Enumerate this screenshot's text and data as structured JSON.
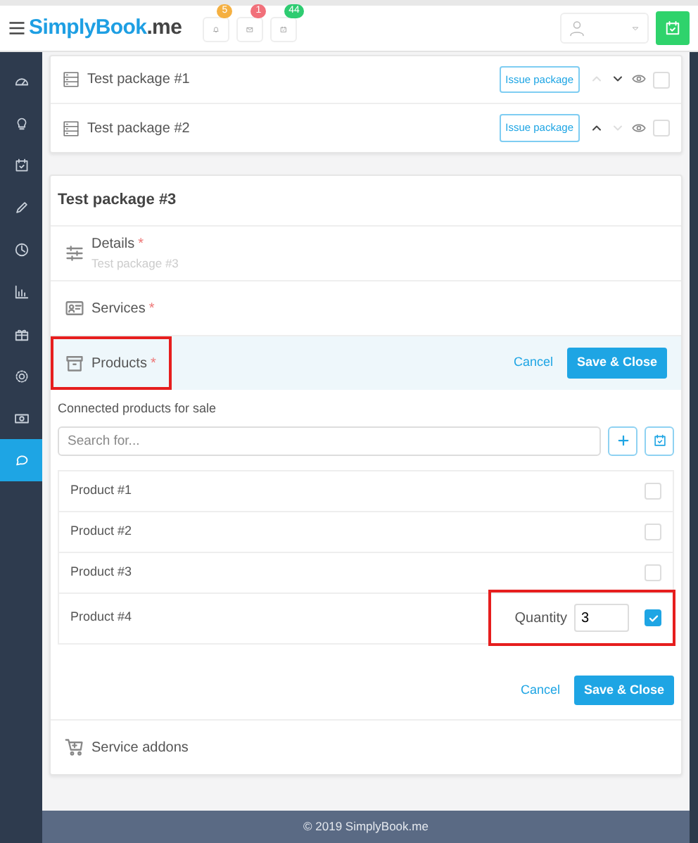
{
  "header": {
    "brand_name": "SimplyBook",
    "brand_suffix": ".me",
    "notifications": [
      {
        "count": "5",
        "color": "#f5b041"
      },
      {
        "count": "1",
        "color": "#f1707a"
      },
      {
        "count": "44",
        "color": "#2ecc71"
      }
    ]
  },
  "sidebar": {
    "items": [
      {
        "selected": false
      },
      {
        "selected": false
      },
      {
        "selected": false
      },
      {
        "selected": false
      },
      {
        "selected": false
      },
      {
        "selected": false
      },
      {
        "selected": false
      },
      {
        "selected": false
      },
      {
        "selected": false
      },
      {
        "selected": true
      }
    ]
  },
  "packages": [
    {
      "name": "Test package #1",
      "action": "Issue package",
      "up_disabled": true,
      "down_disabled": false,
      "checked": false
    },
    {
      "name": "Test package #2",
      "action": "Issue package",
      "up_disabled": false,
      "down_disabled": true,
      "checked": false
    }
  ],
  "editor": {
    "title": "Test package #3",
    "sections": [
      {
        "label": "Details",
        "required_mark": "*",
        "subtitle": "Test package #3",
        "expanded": false,
        "highlighted": false
      },
      {
        "label": "Services",
        "required_mark": "*",
        "expanded": false,
        "highlighted": false
      },
      {
        "label": "Products",
        "required_mark": "*",
        "expanded": true,
        "highlighted": true,
        "cancel": "Cancel",
        "save": "Save & Close"
      }
    ],
    "products_panel": {
      "caption": "Connected products for sale",
      "search_placeholder": "Search for...",
      "products": [
        {
          "name": "Product #1",
          "checked": false,
          "highlighted": false
        },
        {
          "name": "Product #2",
          "checked": false,
          "highlighted": false
        },
        {
          "name": "Product #3",
          "checked": false,
          "highlighted": false
        },
        {
          "name": "Product #4",
          "checked": true,
          "quantity_label": "Quantity",
          "quantity": "3",
          "highlighted": true
        }
      ],
      "cancel": "Cancel",
      "save": "Save & Close"
    },
    "addons": {
      "label": "Service addons"
    }
  },
  "footer": "© 2019 SimplyBook.me"
}
